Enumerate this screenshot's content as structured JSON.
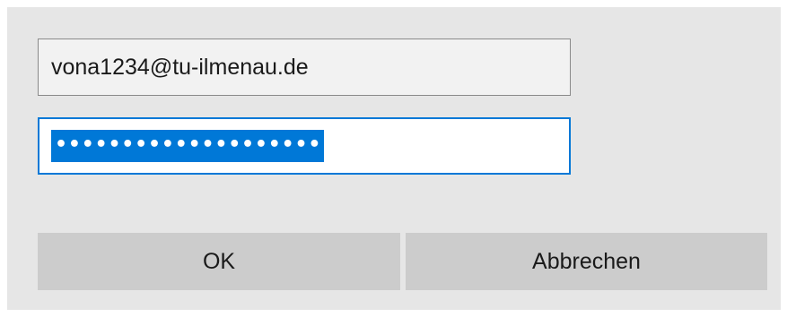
{
  "login": {
    "username_value": "vona1234@tu-ilmenau.de",
    "password_masked": "••••••••••••••••••••"
  },
  "buttons": {
    "ok_label": "OK",
    "cancel_label": "Abbrechen"
  }
}
